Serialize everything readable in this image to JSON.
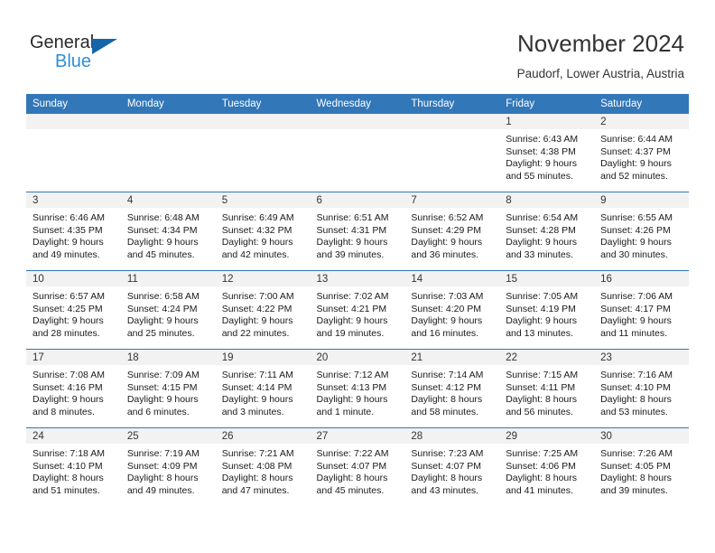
{
  "brand": {
    "name_top": "General",
    "name_bottom": "Blue",
    "triangle_color": "#1565a8",
    "blue_text_color": "#2d8fd5"
  },
  "header": {
    "title": "November 2024",
    "subtitle": "Paudorf, Lower Austria, Austria"
  },
  "theme": {
    "header_bg": "#3277b8",
    "daynum_bg": "#f2f2f2",
    "grid_line": "#3277b8"
  },
  "weekday_headers": [
    "Sunday",
    "Monday",
    "Tuesday",
    "Wednesday",
    "Thursday",
    "Friday",
    "Saturday"
  ],
  "labels": {
    "sunrise_prefix": "Sunrise:",
    "sunset_prefix": "Sunset:",
    "daylight_prefix": "Daylight:"
  },
  "weeks": [
    [
      {
        "day": "",
        "empty": true
      },
      {
        "day": "",
        "empty": true
      },
      {
        "day": "",
        "empty": true
      },
      {
        "day": "",
        "empty": true
      },
      {
        "day": "",
        "empty": true
      },
      {
        "day": "1",
        "sunrise": "Sunrise: 6:43 AM",
        "sunset": "Sunset: 4:38 PM",
        "daylight_line1": "Daylight: 9 hours",
        "daylight_line2": "and 55 minutes."
      },
      {
        "day": "2",
        "sunrise": "Sunrise: 6:44 AM",
        "sunset": "Sunset: 4:37 PM",
        "daylight_line1": "Daylight: 9 hours",
        "daylight_line2": "and 52 minutes."
      }
    ],
    [
      {
        "day": "3",
        "sunrise": "Sunrise: 6:46 AM",
        "sunset": "Sunset: 4:35 PM",
        "daylight_line1": "Daylight: 9 hours",
        "daylight_line2": "and 49 minutes."
      },
      {
        "day": "4",
        "sunrise": "Sunrise: 6:48 AM",
        "sunset": "Sunset: 4:34 PM",
        "daylight_line1": "Daylight: 9 hours",
        "daylight_line2": "and 45 minutes."
      },
      {
        "day": "5",
        "sunrise": "Sunrise: 6:49 AM",
        "sunset": "Sunset: 4:32 PM",
        "daylight_line1": "Daylight: 9 hours",
        "daylight_line2": "and 42 minutes."
      },
      {
        "day": "6",
        "sunrise": "Sunrise: 6:51 AM",
        "sunset": "Sunset: 4:31 PM",
        "daylight_line1": "Daylight: 9 hours",
        "daylight_line2": "and 39 minutes."
      },
      {
        "day": "7",
        "sunrise": "Sunrise: 6:52 AM",
        "sunset": "Sunset: 4:29 PM",
        "daylight_line1": "Daylight: 9 hours",
        "daylight_line2": "and 36 minutes."
      },
      {
        "day": "8",
        "sunrise": "Sunrise: 6:54 AM",
        "sunset": "Sunset: 4:28 PM",
        "daylight_line1": "Daylight: 9 hours",
        "daylight_line2": "and 33 minutes."
      },
      {
        "day": "9",
        "sunrise": "Sunrise: 6:55 AM",
        "sunset": "Sunset: 4:26 PM",
        "daylight_line1": "Daylight: 9 hours",
        "daylight_line2": "and 30 minutes."
      }
    ],
    [
      {
        "day": "10",
        "sunrise": "Sunrise: 6:57 AM",
        "sunset": "Sunset: 4:25 PM",
        "daylight_line1": "Daylight: 9 hours",
        "daylight_line2": "and 28 minutes."
      },
      {
        "day": "11",
        "sunrise": "Sunrise: 6:58 AM",
        "sunset": "Sunset: 4:24 PM",
        "daylight_line1": "Daylight: 9 hours",
        "daylight_line2": "and 25 minutes."
      },
      {
        "day": "12",
        "sunrise": "Sunrise: 7:00 AM",
        "sunset": "Sunset: 4:22 PM",
        "daylight_line1": "Daylight: 9 hours",
        "daylight_line2": "and 22 minutes."
      },
      {
        "day": "13",
        "sunrise": "Sunrise: 7:02 AM",
        "sunset": "Sunset: 4:21 PM",
        "daylight_line1": "Daylight: 9 hours",
        "daylight_line2": "and 19 minutes."
      },
      {
        "day": "14",
        "sunrise": "Sunrise: 7:03 AM",
        "sunset": "Sunset: 4:20 PM",
        "daylight_line1": "Daylight: 9 hours",
        "daylight_line2": "and 16 minutes."
      },
      {
        "day": "15",
        "sunrise": "Sunrise: 7:05 AM",
        "sunset": "Sunset: 4:19 PM",
        "daylight_line1": "Daylight: 9 hours",
        "daylight_line2": "and 13 minutes."
      },
      {
        "day": "16",
        "sunrise": "Sunrise: 7:06 AM",
        "sunset": "Sunset: 4:17 PM",
        "daylight_line1": "Daylight: 9 hours",
        "daylight_line2": "and 11 minutes."
      }
    ],
    [
      {
        "day": "17",
        "sunrise": "Sunrise: 7:08 AM",
        "sunset": "Sunset: 4:16 PM",
        "daylight_line1": "Daylight: 9 hours",
        "daylight_line2": "and 8 minutes."
      },
      {
        "day": "18",
        "sunrise": "Sunrise: 7:09 AM",
        "sunset": "Sunset: 4:15 PM",
        "daylight_line1": "Daylight: 9 hours",
        "daylight_line2": "and 6 minutes."
      },
      {
        "day": "19",
        "sunrise": "Sunrise: 7:11 AM",
        "sunset": "Sunset: 4:14 PM",
        "daylight_line1": "Daylight: 9 hours",
        "daylight_line2": "and 3 minutes."
      },
      {
        "day": "20",
        "sunrise": "Sunrise: 7:12 AM",
        "sunset": "Sunset: 4:13 PM",
        "daylight_line1": "Daylight: 9 hours",
        "daylight_line2": "and 1 minute."
      },
      {
        "day": "21",
        "sunrise": "Sunrise: 7:14 AM",
        "sunset": "Sunset: 4:12 PM",
        "daylight_line1": "Daylight: 8 hours",
        "daylight_line2": "and 58 minutes."
      },
      {
        "day": "22",
        "sunrise": "Sunrise: 7:15 AM",
        "sunset": "Sunset: 4:11 PM",
        "daylight_line1": "Daylight: 8 hours",
        "daylight_line2": "and 56 minutes."
      },
      {
        "day": "23",
        "sunrise": "Sunrise: 7:16 AM",
        "sunset": "Sunset: 4:10 PM",
        "daylight_line1": "Daylight: 8 hours",
        "daylight_line2": "and 53 minutes."
      }
    ],
    [
      {
        "day": "24",
        "sunrise": "Sunrise: 7:18 AM",
        "sunset": "Sunset: 4:10 PM",
        "daylight_line1": "Daylight: 8 hours",
        "daylight_line2": "and 51 minutes."
      },
      {
        "day": "25",
        "sunrise": "Sunrise: 7:19 AM",
        "sunset": "Sunset: 4:09 PM",
        "daylight_line1": "Daylight: 8 hours",
        "daylight_line2": "and 49 minutes."
      },
      {
        "day": "26",
        "sunrise": "Sunrise: 7:21 AM",
        "sunset": "Sunset: 4:08 PM",
        "daylight_line1": "Daylight: 8 hours",
        "daylight_line2": "and 47 minutes."
      },
      {
        "day": "27",
        "sunrise": "Sunrise: 7:22 AM",
        "sunset": "Sunset: 4:07 PM",
        "daylight_line1": "Daylight: 8 hours",
        "daylight_line2": "and 45 minutes."
      },
      {
        "day": "28",
        "sunrise": "Sunrise: 7:23 AM",
        "sunset": "Sunset: 4:07 PM",
        "daylight_line1": "Daylight: 8 hours",
        "daylight_line2": "and 43 minutes."
      },
      {
        "day": "29",
        "sunrise": "Sunrise: 7:25 AM",
        "sunset": "Sunset: 4:06 PM",
        "daylight_line1": "Daylight: 8 hours",
        "daylight_line2": "and 41 minutes."
      },
      {
        "day": "30",
        "sunrise": "Sunrise: 7:26 AM",
        "sunset": "Sunset: 4:05 PM",
        "daylight_line1": "Daylight: 8 hours",
        "daylight_line2": "and 39 minutes."
      }
    ]
  ]
}
